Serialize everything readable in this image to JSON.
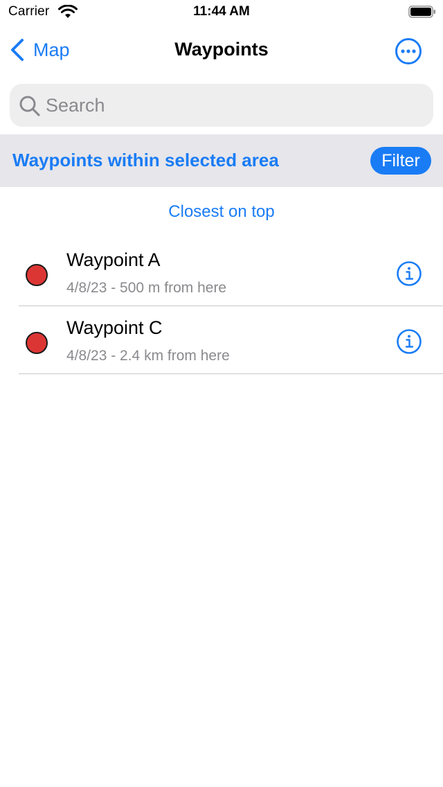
{
  "status_bar": {
    "carrier": "Carrier",
    "time": "11:44 AM",
    "wifi_icon": "wifi-icon",
    "battery_icon": "battery-icon"
  },
  "nav": {
    "back_label": "Map",
    "title": "Waypoints",
    "more_icon": "ellipsis-circle-icon"
  },
  "search": {
    "placeholder": "Search",
    "value": ""
  },
  "filter": {
    "heading": "Waypoints within selected area",
    "button_label": "Filter"
  },
  "sort": {
    "label": "Closest on top"
  },
  "waypoints": [
    {
      "name": "Waypoint A",
      "detail": "4/8/23 - 500 m from here",
      "marker_color": "#dc3634"
    },
    {
      "name": "Waypoint C",
      "detail": "4/8/23 - 2.4 km from here",
      "marker_color": "#dc3634"
    }
  ],
  "colors": {
    "accent": "#1a7cf5",
    "secondary_text": "#8a8a8e",
    "section_background": "#e6e6eb",
    "search_background": "#eeeeef"
  }
}
